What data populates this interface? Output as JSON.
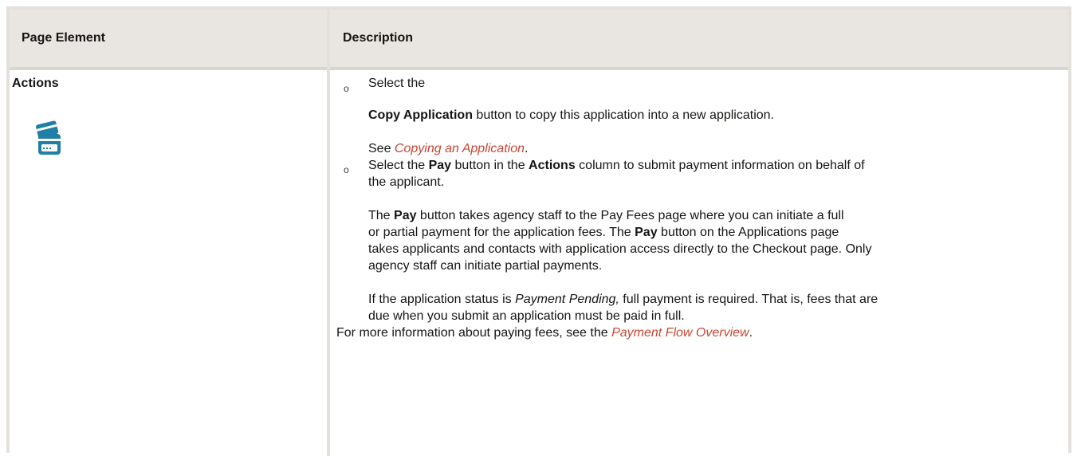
{
  "table": {
    "headers": [
      "Page Element",
      "Description"
    ]
  },
  "row": {
    "element": "Actions",
    "icon": "credit-card-pay-icon",
    "items": {
      "b1_a": "Select the",
      "b1_b_bold": "Copy Application",
      "b1_b_rest": " button to copy this application into a new application.",
      "b1_c_pre": "See ",
      "b1_c_link": "Copying an Application",
      "b1_c_post": ".",
      "b2_l1_a": "Select the ",
      "b2_l1_b": "Pay",
      "b2_l1_c": " button in the ",
      "b2_l1_d": "Actions",
      "b2_l1_e": " column to submit payment information on behalf of",
      "b2_l2": "the applicant.",
      "p3_l1_a": "The ",
      "p3_l1_b": "Pay",
      "p3_l1_c": " button takes agency staff to the Pay Fees page where you can initiate a full",
      "p3_l2_a": "or partial payment for the application fees. The ",
      "p3_l2_b": "Pay",
      "p3_l2_c": " button on the Applications page",
      "p3_l3": "takes applicants and contacts with application access directly to the Checkout page. Only",
      "p3_l4": "agency staff can initiate partial payments.",
      "p4_l1_a": "If the application status is ",
      "p4_l1_b": "Payment Pending,",
      "p4_l1_c": " full payment is required. That is, fees that are",
      "p4_l2": "due when you submit an application must be paid in full.",
      "p5_a": "For more information about paying fees, see the ",
      "p5_link": "Payment Flow Overview",
      "p5_c": "."
    },
    "bullet_char": "o"
  },
  "colors": {
    "link": "#c74634",
    "header_bg": "#e9e6e1",
    "icon": "#1f7fa6"
  }
}
